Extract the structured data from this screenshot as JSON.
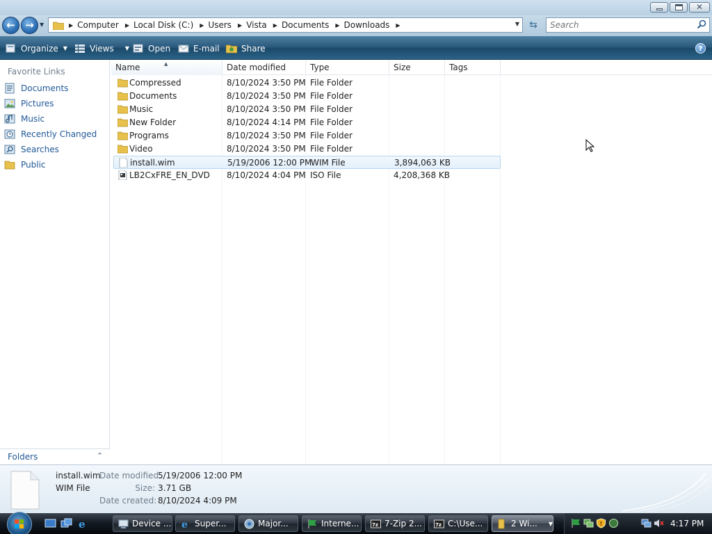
{
  "address": {
    "breadcrumb": [
      "Computer",
      "Local Disk (C:)",
      "Users",
      "Vista",
      "Documents",
      "Downloads"
    ]
  },
  "search": {
    "placeholder": "Search"
  },
  "toolbar": {
    "organize": "Organize",
    "views": "Views",
    "open": "Open",
    "email": "E-mail",
    "share": "Share",
    "help": "?"
  },
  "sidebar": {
    "heading": "Favorite Links",
    "items": [
      {
        "label": "Documents",
        "icon": "documents-icon"
      },
      {
        "label": "Pictures",
        "icon": "pictures-icon"
      },
      {
        "label": "Music",
        "icon": "music-icon"
      },
      {
        "label": "Recently Changed",
        "icon": "recent-icon"
      },
      {
        "label": "Searches",
        "icon": "searches-icon"
      },
      {
        "label": "Public",
        "icon": "folder-icon"
      }
    ],
    "folders_label": "Folders"
  },
  "columns": {
    "name": "Name",
    "date": "Date modified",
    "type": "Type",
    "size": "Size",
    "tags": "Tags"
  },
  "files": [
    {
      "name": "Compressed",
      "date": "8/10/2024 3:50 PM",
      "type": "File Folder",
      "size": "",
      "icon": "folder-icon"
    },
    {
      "name": "Documents",
      "date": "8/10/2024 3:50 PM",
      "type": "File Folder",
      "size": "",
      "icon": "folder-icon"
    },
    {
      "name": "Music",
      "date": "8/10/2024 3:50 PM",
      "type": "File Folder",
      "size": "",
      "icon": "folder-icon"
    },
    {
      "name": "New Folder",
      "date": "8/10/2024 4:14 PM",
      "type": "File Folder",
      "size": "",
      "icon": "folder-icon"
    },
    {
      "name": "Programs",
      "date": "8/10/2024 3:50 PM",
      "type": "File Folder",
      "size": "",
      "icon": "folder-icon"
    },
    {
      "name": "Video",
      "date": "8/10/2024 3:50 PM",
      "type": "File Folder",
      "size": "",
      "icon": "folder-icon"
    },
    {
      "name": "install.wim",
      "date": "5/19/2006 12:00 PM",
      "type": "WIM File",
      "size": "3,894,063 KB",
      "icon": "file-icon",
      "selected": true
    },
    {
      "name": "LB2CxFRE_EN_DVD",
      "date": "8/10/2024 4:04 PM",
      "type": "ISO File",
      "size": "4,208,368 KB",
      "icon": "iso-icon"
    }
  ],
  "details": {
    "name": "install.wim",
    "kind": "WIM File",
    "modified_label": "Date modified:",
    "modified_value": "5/19/2006 12:00 PM",
    "size_label": "Size:",
    "size_value": "3.71 GB",
    "created_label": "Date created:",
    "created_value": "8/10/2024 4:09 PM"
  },
  "taskbar": {
    "tasks": [
      {
        "label": "Device ...",
        "icon": "device-manager-icon"
      },
      {
        "label": "Super...",
        "icon": "ie-icon"
      },
      {
        "label": "Major...",
        "icon": "chrome-icon"
      },
      {
        "label": "Interne...",
        "icon": "flag-icon"
      },
      {
        "label": "7-Zip 2...",
        "icon": "7zip-icon"
      },
      {
        "label": "C:\\Use...",
        "icon": "7zip-icon"
      },
      {
        "label": "2 Wi...",
        "icon": "explorer-icon",
        "active": true
      }
    ],
    "clock": "4:17 PM"
  },
  "colors": {
    "link": "#1f5796",
    "command_bar": "#27587c",
    "selection": "#e3f0fb"
  }
}
